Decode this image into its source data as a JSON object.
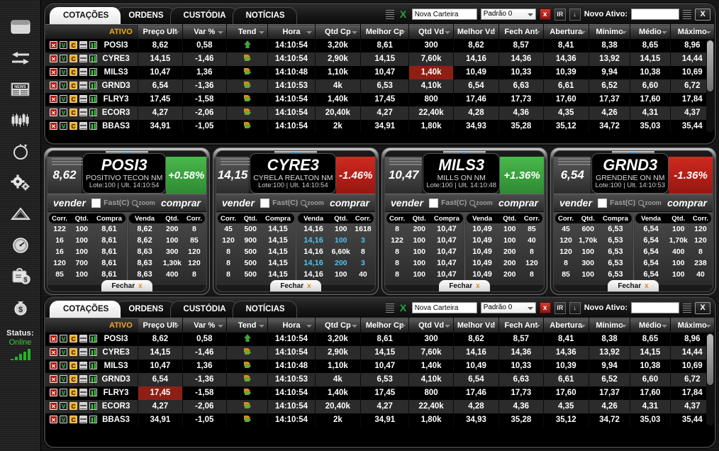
{
  "sidebar": {
    "icons": [
      {
        "name": "window-panel-icon"
      },
      {
        "name": "transfer-arrows-icon"
      },
      {
        "name": "news-icon",
        "label": "NEWS"
      },
      {
        "name": "candlestick-chart-icon"
      },
      {
        "name": "compass-icon"
      },
      {
        "name": "gears-icon"
      },
      {
        "name": "alert-triangle-icon"
      },
      {
        "name": "gauge-clock-icon"
      },
      {
        "name": "briefcase-money-icon"
      },
      {
        "name": "money-bag-icon"
      }
    ],
    "status_label": "Status:",
    "status_value": "Online",
    "signal_bars": 5
  },
  "tabs": [
    {
      "id": "cotacoes",
      "label": "COTAÇÕES",
      "active": true
    },
    {
      "id": "ordens",
      "label": "ORDENS",
      "active": false
    },
    {
      "id": "custodia",
      "label": "CUSTÓDIA",
      "active": false
    },
    {
      "id": "noticias",
      "label": "NOTÍCIAS",
      "active": false
    }
  ],
  "toolbar": {
    "excel_icon": "X",
    "carteira_value": "Nova Carteira",
    "carteira_placeholder": "Nova Carteira",
    "padrao_value": "Padrão 0",
    "delete_button": "x",
    "ir_button": "IR",
    "export_button": "↓",
    "novo_ativo_label": "Novo Ativo:",
    "novo_ativo_value": "",
    "close_button": "X"
  },
  "table": {
    "columns": [
      {
        "key": "icons",
        "label": "",
        "caret": false
      },
      {
        "key": "ativo",
        "label": "ATIVO",
        "caret": false
      },
      {
        "key": "preco_ult",
        "label": "Preço Ult",
        "caret": true
      },
      {
        "key": "var_pct",
        "label": "Var %",
        "caret": true
      },
      {
        "key": "tend",
        "label": "Tend",
        "caret": true
      },
      {
        "key": "hora",
        "label": "Hora",
        "caret": true
      },
      {
        "key": "qtd_cp",
        "label": "Qtd Cp",
        "caret": true
      },
      {
        "key": "melhor_cp",
        "label": "Melhor Cp",
        "caret": true
      },
      {
        "key": "qtd_vd",
        "label": "Qtd Vd",
        "caret": true
      },
      {
        "key": "melhor_vd",
        "label": "Melhor Vd",
        "caret": true
      },
      {
        "key": "fech_ant",
        "label": "Fech Ant",
        "caret": true
      },
      {
        "key": "abertura",
        "label": "Abertura",
        "caret": true
      },
      {
        "key": "minimo",
        "label": "Mínimo",
        "caret": true
      },
      {
        "key": "medio",
        "label": "Médio",
        "caret": true
      },
      {
        "key": "maximo",
        "label": "Máximo",
        "caret": true
      }
    ],
    "row_icons": [
      "close-row-icon",
      "sell-v-icon",
      "buy-c-icon",
      "book-list-icon",
      "chart-icon"
    ],
    "rows": [
      {
        "ativo": "POSI3",
        "preco_ult": "8,62",
        "var_pct": "0,58",
        "var_dir": "up",
        "tend": "up",
        "hora": "14:10:54",
        "qtd_cp": "3,20k",
        "melhor_cp": "8,61",
        "qtd_vd": "300",
        "melhor_vd": "8,62",
        "fech_ant": "8,57",
        "abertura": "8,41",
        "minimo": "8,38",
        "medio": "8,65",
        "maximo": "8,96"
      },
      {
        "ativo": "CYRE3",
        "preco_ult": "14,15",
        "var_pct": "-1,46",
        "var_dir": "down",
        "tend": "flat",
        "hora": "14:10:54",
        "qtd_cp": "2,90k",
        "melhor_cp": "14,15",
        "qtd_vd": "7,60k",
        "melhor_vd": "14,16",
        "fech_ant": "14,36",
        "abertura": "14,36",
        "minimo": "13,92",
        "medio": "14,15",
        "maximo": "14,44"
      },
      {
        "ativo": "MILS3",
        "preco_ult": "10,47",
        "var_pct": "1,36",
        "var_dir": "up",
        "tend": "flat",
        "hora": "14:10:48",
        "qtd_cp": "1,10k",
        "melhor_cp": "10,47",
        "qtd_vd": "1,40k",
        "melhor_vd": "10,49",
        "fech_ant": "10,33",
        "abertura": "10,39",
        "minimo": "9,94",
        "medio": "10,38",
        "maximo": "10,69",
        "highlight": "qtd_vd"
      },
      {
        "ativo": "GRND3",
        "preco_ult": "6,54",
        "var_pct": "-1,36",
        "var_dir": "down",
        "tend": "flat",
        "hora": "14:10:53",
        "qtd_cp": "4k",
        "melhor_cp": "6,53",
        "qtd_vd": "4,10k",
        "melhor_vd": "6,54",
        "fech_ant": "6,63",
        "abertura": "6,61",
        "minimo": "6,52",
        "medio": "6,60",
        "maximo": "6,72"
      },
      {
        "ativo": "FLRY3",
        "preco_ult": "17,45",
        "var_pct": "-1,58",
        "var_dir": "down",
        "tend": "flat",
        "hora": "14:10:54",
        "qtd_cp": "1,40k",
        "melhor_cp": "17,45",
        "qtd_vd": "800",
        "melhor_vd": "17,46",
        "fech_ant": "17,73",
        "abertura": "17,60",
        "minimo": "17,37",
        "medio": "17,60",
        "maximo": "17,84"
      },
      {
        "ativo": "ECOR3",
        "preco_ult": "4,27",
        "var_pct": "-2,06",
        "var_dir": "down",
        "tend": "flat",
        "hora": "14:10:54",
        "qtd_cp": "20,40k",
        "melhor_cp": "4,27",
        "qtd_vd": "22,40k",
        "melhor_vd": "4,28",
        "fech_ant": "4,36",
        "abertura": "4,35",
        "minimo": "4,26",
        "medio": "4,31",
        "maximo": "4,37"
      },
      {
        "ativo": "BBAS3",
        "preco_ult": "34,91",
        "var_pct": "-1,05",
        "var_dir": "down",
        "tend": "flat",
        "hora": "14:10:54",
        "qtd_cp": "2k",
        "melhor_cp": "34,91",
        "qtd_vd": "1,80k",
        "melhor_vd": "34,93",
        "fech_ant": "35,28",
        "abertura": "35,12",
        "minimo": "34,72",
        "medio": "35,03",
        "maximo": "35,44"
      }
    ],
    "rows_bottom_highlight": {
      "ativo": "FLRY3",
      "column": "preco_ult"
    }
  },
  "cards": {
    "controls": {
      "vender": "vender",
      "comprar": "comprar",
      "fast_label": "Fast(C)",
      "zoom_label": "zoom",
      "fechar": "Fechar",
      "fechar_x": "x"
    },
    "book_headers": {
      "buy": [
        "Corr.",
        "Qtd.",
        "Compra"
      ],
      "sell": [
        "Venda",
        "Qtd.",
        "Corr."
      ]
    },
    "items": [
      {
        "symbol": "POSI3",
        "name": "POSITIVO TECON NM",
        "sub": "Lote:100 | Ult. 14:10:54",
        "last": "8,62",
        "var": "+0.58%",
        "dir": "up",
        "buy": [
          {
            "corr": "122",
            "qtd": "100",
            "price": "8,61"
          },
          {
            "corr": "16",
            "qtd": "100",
            "price": "8,61"
          },
          {
            "corr": "16",
            "qtd": "100",
            "price": "8,61"
          },
          {
            "corr": "120",
            "qtd": "700",
            "price": "8,61"
          },
          {
            "corr": "85",
            "qtd": "100",
            "price": "8,61"
          }
        ],
        "sell": [
          {
            "price": "8,62",
            "qtd": "200",
            "corr": "8"
          },
          {
            "price": "8,62",
            "qtd": "100",
            "corr": "85"
          },
          {
            "price": "8,63",
            "qtd": "300",
            "corr": "120"
          },
          {
            "price": "8,63",
            "qtd": "1,30k",
            "corr": "120"
          },
          {
            "price": "8,63",
            "qtd": "400",
            "corr": "8"
          }
        ]
      },
      {
        "symbol": "CYRE3",
        "name": "CYRELA REALTON NM",
        "sub": "Lote:100 | Ult. 14:10:54",
        "last": "14,15",
        "var": "-1.46%",
        "dir": "down",
        "buy": [
          {
            "corr": "45",
            "qtd": "500",
            "price": "14,15"
          },
          {
            "corr": "120",
            "qtd": "900",
            "price": "14,15"
          },
          {
            "corr": "8",
            "qtd": "500",
            "price": "14,15"
          },
          {
            "corr": "8",
            "qtd": "500",
            "price": "14,15"
          },
          {
            "corr": "8",
            "qtd": "500",
            "price": "14,15"
          }
        ],
        "sell": [
          {
            "price": "14,16",
            "qtd": "100",
            "corr": "1618"
          },
          {
            "price": "14,16",
            "qtd": "100",
            "corr": "3",
            "cyan": true
          },
          {
            "price": "14,16",
            "qtd": "6,60k",
            "corr": "8"
          },
          {
            "price": "14,16",
            "qtd": "200",
            "corr": "3",
            "cyan": true
          },
          {
            "price": "14,16",
            "qtd": "100",
            "corr": "40"
          }
        ]
      },
      {
        "symbol": "MILS3",
        "name": "MILLS ON NM",
        "sub": "Lote:100 | Ult. 14:10:48",
        "last": "10,47",
        "var": "+1.36%",
        "dir": "up",
        "buy": [
          {
            "corr": "8",
            "qtd": "200",
            "price": "10,47"
          },
          {
            "corr": "122",
            "qtd": "100",
            "price": "10,47"
          },
          {
            "corr": "8",
            "qtd": "100",
            "price": "10,47"
          },
          {
            "corr": "8",
            "qtd": "100",
            "price": "10,47"
          },
          {
            "corr": "8",
            "qtd": "100",
            "price": "10,47"
          }
        ],
        "sell": [
          {
            "price": "10,49",
            "qtd": "100",
            "corr": "85"
          },
          {
            "price": "10,49",
            "qtd": "100",
            "corr": "40"
          },
          {
            "price": "10,49",
            "qtd": "200",
            "corr": "8"
          },
          {
            "price": "10,49",
            "qtd": "200",
            "corr": "120"
          },
          {
            "price": "10,49",
            "qtd": "200",
            "corr": "8"
          }
        ]
      },
      {
        "symbol": "GRND3",
        "name": "GRENDENE ON NM",
        "sub": "Lote:100 | Ult. 14:10:53",
        "last": "6,54",
        "var": "-1.36%",
        "dir": "down",
        "buy": [
          {
            "corr": "45",
            "qtd": "600",
            "price": "6,53"
          },
          {
            "corr": "120",
            "qtd": "1,70k",
            "price": "6,53"
          },
          {
            "corr": "120",
            "qtd": "100",
            "price": "6,53"
          },
          {
            "corr": "8",
            "qtd": "300",
            "price": "6,53"
          },
          {
            "corr": "85",
            "qtd": "100",
            "price": "6,53"
          }
        ],
        "sell": [
          {
            "price": "6,54",
            "qtd": "100",
            "corr": "120"
          },
          {
            "price": "6,54",
            "qtd": "1,70k",
            "corr": "120"
          },
          {
            "price": "6,54",
            "qtd": "400",
            "corr": "8"
          },
          {
            "price": "6,54",
            "qtd": "100",
            "corr": "238"
          },
          {
            "price": "6,54",
            "qtd": "100",
            "corr": "40"
          }
        ]
      }
    ]
  },
  "colors": {
    "accent_orange": "#f5a623",
    "up_green": "#2ecc40",
    "down_red": "#e03a2f",
    "highlight_red": "#8e1f14",
    "cyan": "#4ec3ef"
  }
}
